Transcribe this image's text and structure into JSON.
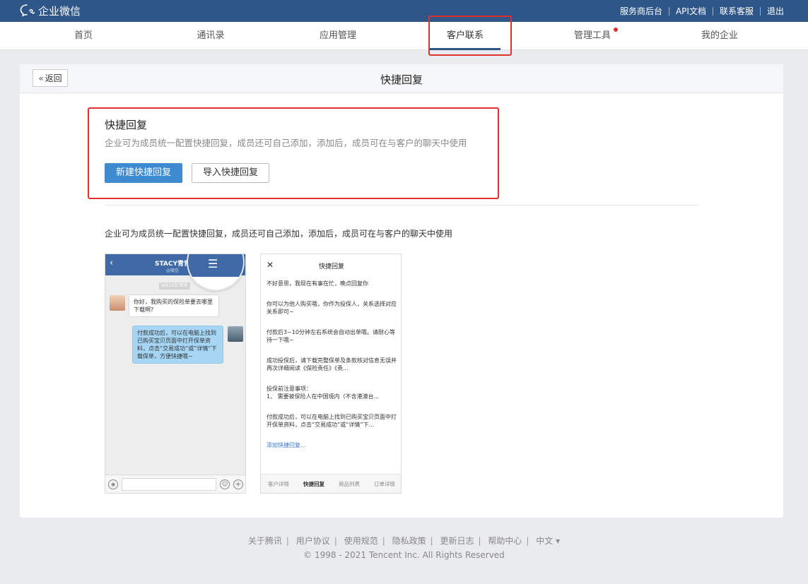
{
  "topbar": {
    "logo_text": "企业微信",
    "links": [
      "服务商后台",
      "API文档",
      "联系客服",
      "退出"
    ]
  },
  "nav": {
    "items": [
      "首页",
      "通讯录",
      "应用管理",
      "客户联系",
      "管理工具",
      "我的企业"
    ],
    "active_index": 3
  },
  "page": {
    "back_label": "返回",
    "title": "快捷回复"
  },
  "section": {
    "title": "快捷回复",
    "description": "企业可为成员统一配置快捷回复，成员还可自己添加，添加后，成员可在与客户的聊天中使用",
    "new_button": "新建快捷回复",
    "import_button": "导入快捷回复",
    "intro": "企业可为成员统一配置快捷回复，成员还可自己添加，添加后，成员可在与客户的聊天中使用"
  },
  "phone_chat": {
    "contact_name": "STACY青青",
    "contact_sub": "@微信",
    "date": "9月12日 昨天",
    "msg_customer": "你好，我购买的保险单要去哪里下载啊?",
    "msg_agent": "付款成功后，可以在电脑上找到已购买宝贝页面中打开保单资料，点击“交易成功”或“详情”下载保单，方便快捷哦~"
  },
  "phone_panel": {
    "title": "快捷回复",
    "replies": [
      "不好意思，我现在有事在忙，晚点回复你",
      "你可以为他人购买哦，你作为投保人，关系选择对应关系即可~",
      "付款后3~10分钟左右系统会自动出单哦。请耐心等待一下哦~",
      "成功投保后，请下载完整保单及条款核对信息无误并再次详细阅读《保险责任》《责...",
      "投保前注意事项：\n1、 需要被保险人在中国境内（不含港澳台...",
      "付款成功后，可以在电脑上找到已购买宝贝页面中打开保单资料，点击“交易成功”或“详情”下..."
    ],
    "add_link": "添加快捷回复...",
    "tabs": [
      "客户详情",
      "快捷回复",
      "商品列表",
      "订单详情"
    ],
    "active_tab": 1
  },
  "footer": {
    "links": [
      "关于腾讯",
      "用户协议",
      "使用规范",
      "隐私政策",
      "更新日志",
      "帮助中心"
    ],
    "language": "中文 ▾",
    "copyright": "© 1998 - 2021 Tencent Inc. All Rights Reserved"
  },
  "colors": {
    "topbar": "#2f5689",
    "primary_button": "#3d8ad1",
    "highlight": "#e0302b"
  }
}
